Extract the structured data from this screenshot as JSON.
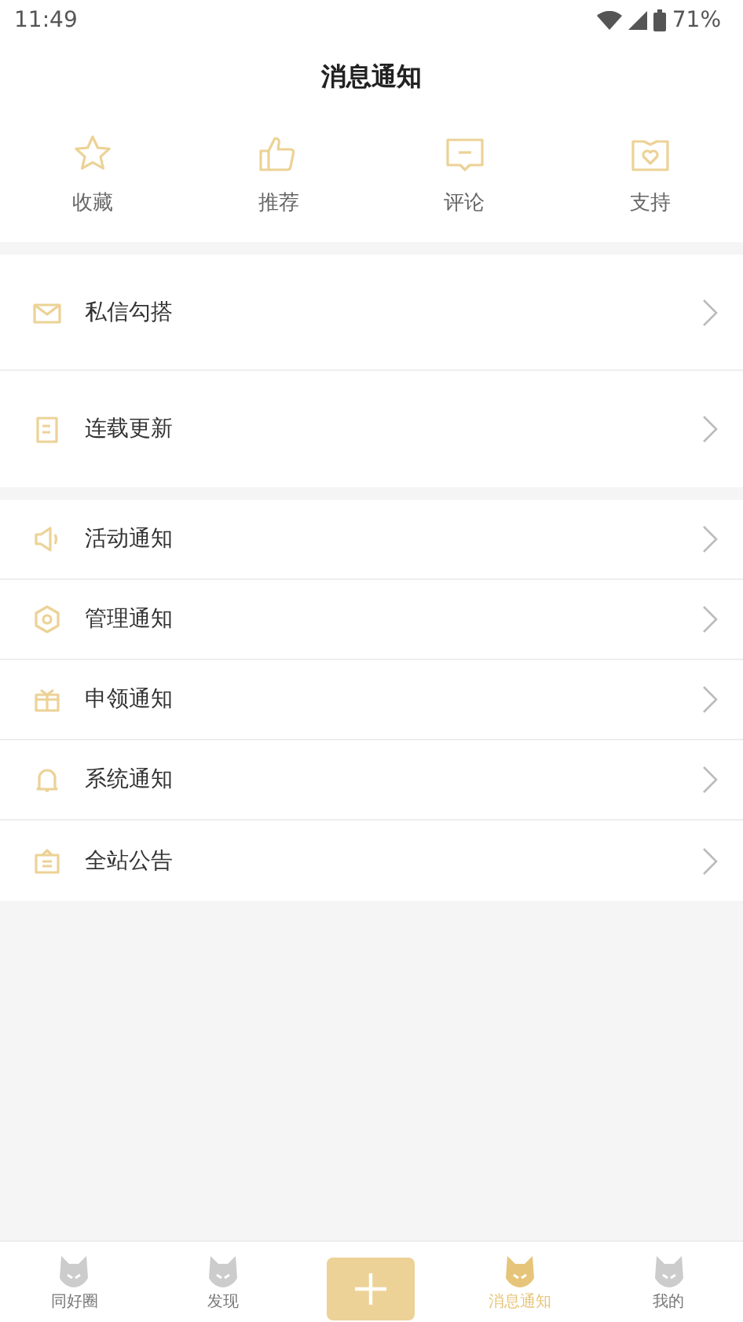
{
  "status_bar": {
    "time": "11:49",
    "battery": "71%"
  },
  "header": {
    "title": "消息通知"
  },
  "quick_actions": [
    {
      "label": "收藏"
    },
    {
      "label": "推荐"
    },
    {
      "label": "评论"
    },
    {
      "label": "支持"
    }
  ],
  "groups": [
    {
      "items": [
        {
          "label": "私信勾搭"
        },
        {
          "label": "连载更新"
        }
      ]
    },
    {
      "items": [
        {
          "label": "活动通知"
        },
        {
          "label": "管理通知"
        },
        {
          "label": "申领通知"
        },
        {
          "label": "系统通知"
        },
        {
          "label": "全站公告"
        }
      ]
    }
  ],
  "bottom_nav": [
    {
      "label": "同好圈",
      "selected": false
    },
    {
      "label": "发现",
      "selected": false
    },
    {
      "kind": "add"
    },
    {
      "label": "消息通知",
      "selected": true
    },
    {
      "label": "我的",
      "selected": false
    }
  ]
}
